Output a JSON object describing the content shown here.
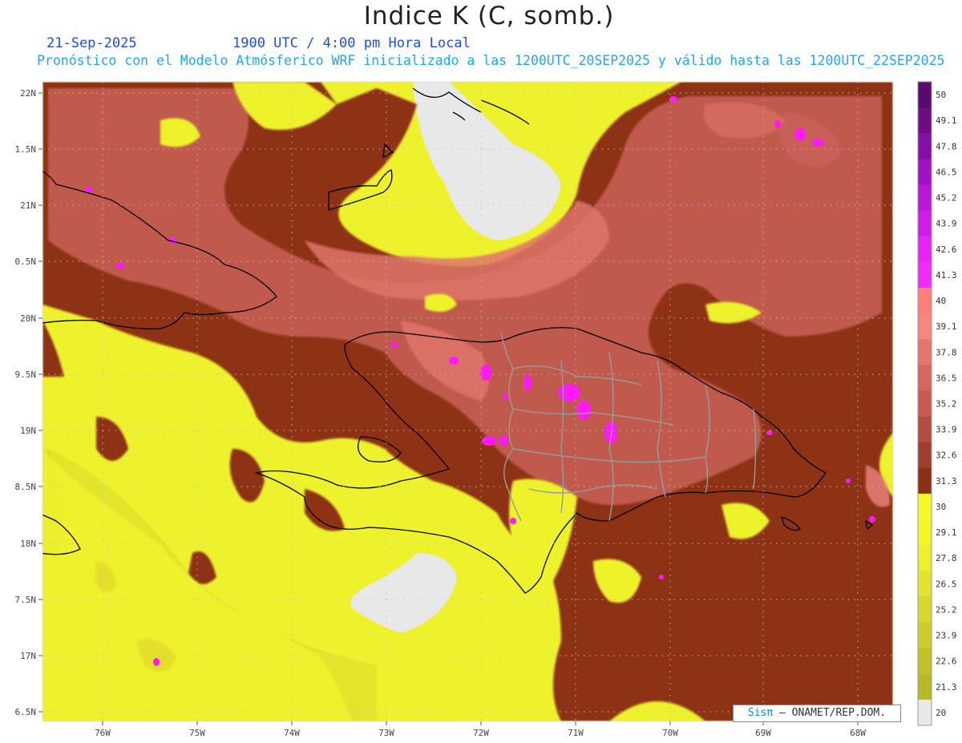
{
  "title": "Indice K (C, somb.)",
  "date_label": "21-Sep-2025",
  "time_label": "1900 UTC / 4:00 pm Hora Local",
  "description": "Pronóstico con el Modelo Atmósferico WRF inicializado a las 1200UTC_20SEP2025 y válido hasta las  1200UTC_22SEP2025",
  "credit": {
    "sis": "Sisπ",
    "rest": " – ONAMET/REP.DOM."
  },
  "map": {
    "lon_labels": [
      "76W",
      "75W",
      "74W",
      "73W",
      "72W",
      "71W",
      "70W",
      "69W",
      "68W"
    ],
    "lat_labels": [
      "22N",
      "1.5N",
      "21N",
      "0.5N",
      "20N",
      "9.5N",
      "19N",
      "8.5N",
      "18N",
      "7.5N",
      "17N",
      "6.5N"
    ]
  },
  "legend": {
    "levels": [
      {
        "label": "50",
        "color": "#5a0a6a"
      },
      {
        "label": "49.1",
        "color": "#6e0c86"
      },
      {
        "label": "47.8",
        "color": "#8410a6"
      },
      {
        "label": "46.5",
        "color": "#9e14c2"
      },
      {
        "label": "45.2",
        "color": "#b818d8"
      },
      {
        "label": "43.9",
        "color": "#d01ee8"
      },
      {
        "label": "42.6",
        "color": "#e624f4"
      },
      {
        "label": "41.3",
        "color": "#f02cf8"
      },
      {
        "label": "40",
        "color": "#ff7f78"
      },
      {
        "label": "39.1",
        "color": "#f5877e"
      },
      {
        "label": "37.8",
        "color": "#e6756c"
      },
      {
        "label": "36.5",
        "color": "#d8665e"
      },
      {
        "label": "35.2",
        "color": "#c85a52"
      },
      {
        "label": "33.9",
        "color": "#b44c42"
      },
      {
        "label": "32.6",
        "color": "#a03e30"
      },
      {
        "label": "31.3",
        "color": "#8c3018"
      },
      {
        "label": "30",
        "color": "#f8fa28"
      },
      {
        "label": "29.1",
        "color": "#f4f62a"
      },
      {
        "label": "27.8",
        "color": "#eeef2c"
      },
      {
        "label": "26.5",
        "color": "#e4e42e"
      },
      {
        "label": "25.2",
        "color": "#d8d82c"
      },
      {
        "label": "23.9",
        "color": "#cccc2a"
      },
      {
        "label": "22.6",
        "color": "#c2c228"
      },
      {
        "label": "21.3",
        "color": "#b8b826"
      },
      {
        "label": "20",
        "color": "#e8e8e8"
      }
    ]
  },
  "colors": {
    "yellow": "#eaef2a",
    "yellow_bright": "#f5f82c",
    "dark_brown": "#8c3018",
    "salmon": "#c25a50",
    "pink": "#e87870",
    "magenta": "#ff19ff",
    "gray_low": "#e8e8e8",
    "border_line": "#9a9a9a"
  }
}
